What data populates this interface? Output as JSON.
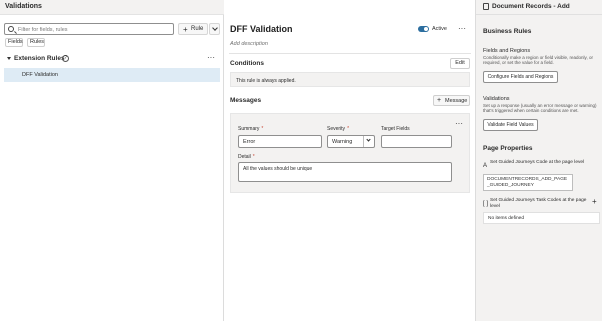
{
  "left": {
    "title": "Validations",
    "search_placeholder": "Filter for fields, rules",
    "rule_button": "Rule",
    "filters": [
      "Fields",
      "Rules"
    ],
    "group_label": "Extension Rules",
    "rule_item": "DFF Validation"
  },
  "middle": {
    "title": "DFF Validation",
    "active_label": "Active",
    "add_description": "Add description",
    "conditions_heading": "Conditions",
    "edit_label": "Edit",
    "condition_text": "This rule is always applied.",
    "messages_heading": "Messages",
    "message_button": "Message",
    "summary_label": "Summary",
    "summary_value": "Error",
    "severity_label": "Severity",
    "severity_value": "Warning",
    "target_label": "Target Fields",
    "target_value": "",
    "detail_label": "Detail",
    "detail_value": "All the values should be unique"
  },
  "right": {
    "title": "Document Records - Add",
    "business_rules_heading": "Business Rules",
    "fields_regions_title": "Fields and Regions",
    "fields_regions_desc": "Conditionally make a region or field visible, readonly, or required, or set the value for a field.",
    "fields_regions_button": "Configure Fields and Regions",
    "validations_title": "Validations",
    "validations_desc": "Set up a response (usually an error message or warning) that's triggered when certain conditions are met.",
    "validations_button": "Validate Field Values",
    "page_properties_heading": "Page Properties",
    "guided_journey_label": "Set Guided Journeys Code at the page level",
    "guided_journey_value": "DOCUMENTRECORDS_ADD_PAGE_GUIDED_JOURNEY",
    "task_codes_label": "Set Guided Journeys Task Codes at the page level",
    "task_codes_value": "No items defined"
  },
  "icons": {
    "search": "search-icon",
    "expand": "expand-icon",
    "close": "close-icon",
    "more": "more-icon"
  },
  "colors": {
    "accent": "#2c6e9f",
    "selected_row": "#deebf5",
    "required": "#c74634",
    "panel_bg": "#f3f2f1"
  }
}
